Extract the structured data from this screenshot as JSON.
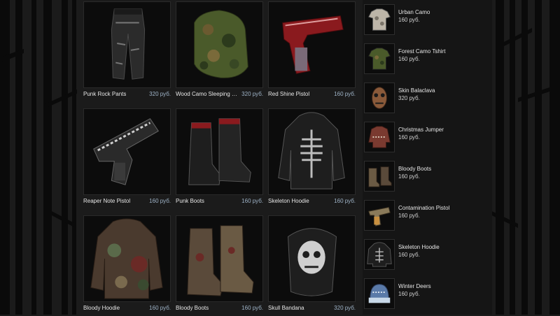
{
  "catalog": {
    "items": [
      {
        "name": "Punk Rock Pants",
        "price": "320 руб.",
        "icon": "pants-icon"
      },
      {
        "name": "Wood Camo Sleeping Bag",
        "price": "320 руб.",
        "icon": "sleeping-bag-icon"
      },
      {
        "name": "Red Shine Pistol",
        "price": "160 руб.",
        "icon": "pistol-icon"
      },
      {
        "name": "Reaper Note Pistol",
        "price": "160 руб.",
        "icon": "pistol-icon"
      },
      {
        "name": "Punk Boots",
        "price": "160 руб.",
        "icon": "boots-icon"
      },
      {
        "name": "Skeleton Hoodie",
        "price": "160 руб.",
        "icon": "hoodie-icon"
      },
      {
        "name": "Bloody Hoodie",
        "price": "160 руб.",
        "icon": "hoodie-icon"
      },
      {
        "name": "Bloody Boots",
        "price": "160 руб.",
        "icon": "boots-icon"
      },
      {
        "name": "Skull Bandana",
        "price": "320 руб.",
        "icon": "bandana-icon"
      }
    ]
  },
  "sidebar": {
    "items": [
      {
        "name": "Urban Camo",
        "price": "160 руб.",
        "icon": "tshirt-icon"
      },
      {
        "name": "Forest Camo Tshirt",
        "price": "160 руб.",
        "icon": "tshirt-icon"
      },
      {
        "name": "Skin Balaclava",
        "price": "320 руб.",
        "icon": "balaclava-icon"
      },
      {
        "name": "Christmas Jumper",
        "price": "160 руб.",
        "icon": "jumper-icon"
      },
      {
        "name": "Bloody Boots",
        "price": "160 руб.",
        "icon": "boots-icon"
      },
      {
        "name": "Contamination Pistol",
        "price": "160 руб.",
        "icon": "pistol-icon"
      },
      {
        "name": "Skeleton Hoodie",
        "price": "160 руб.",
        "icon": "hoodie-icon"
      },
      {
        "name": "Winter Deers",
        "price": "160 руб.",
        "icon": "beanie-icon"
      }
    ]
  },
  "colors": {
    "background": "#1b1b1b",
    "card_background": "#0c0c0c",
    "price_text": "#9fb4c8"
  }
}
